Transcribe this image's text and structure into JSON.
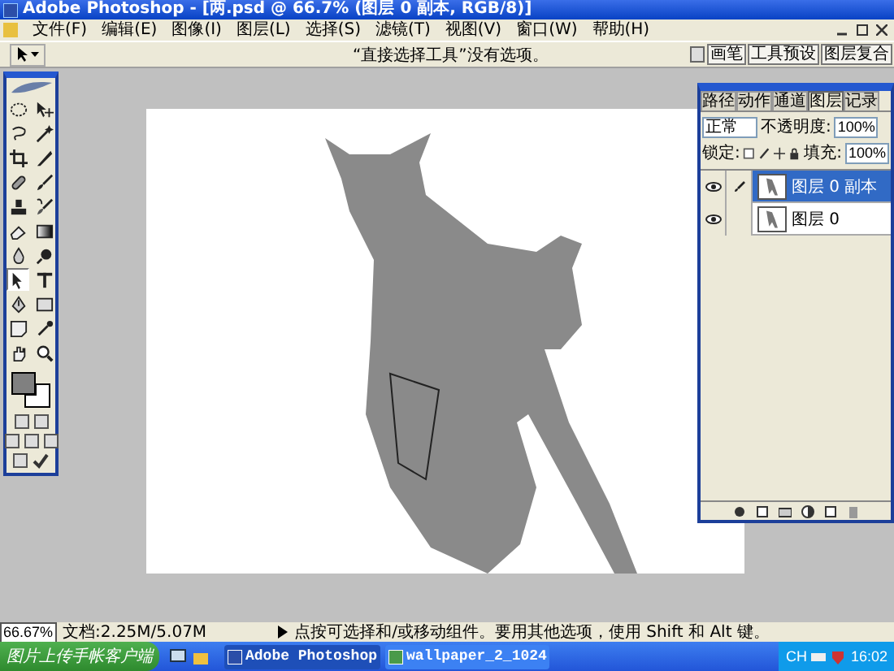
{
  "window": {
    "title": "Adobe Photoshop - [两.psd @ 66.7% (图层 0 副本, RGB/8)]"
  },
  "menu": [
    "文件(F)",
    "编辑(E)",
    "图像(I)",
    "图层(L)",
    "选择(S)",
    "滤镜(T)",
    "视图(V)",
    "窗口(W)",
    "帮助(H)"
  ],
  "options_bar": {
    "hint": "“直接选择工具”没有选项。",
    "palette_well": [
      "画笔",
      "工具预设",
      "图层复合"
    ]
  },
  "toolbox": {
    "tools": [
      {
        "kind": "marquee",
        "selected": false
      },
      {
        "kind": "move",
        "selected": false
      },
      {
        "kind": "lasso",
        "selected": false
      },
      {
        "kind": "wand",
        "selected": false
      },
      {
        "kind": "crop",
        "selected": false
      },
      {
        "kind": "slice",
        "selected": false
      },
      {
        "kind": "healing",
        "selected": false
      },
      {
        "kind": "brush",
        "selected": false
      },
      {
        "kind": "stamp",
        "selected": false
      },
      {
        "kind": "history",
        "selected": false
      },
      {
        "kind": "eraser",
        "selected": false
      },
      {
        "kind": "gradient",
        "selected": false
      },
      {
        "kind": "blur",
        "selected": false
      },
      {
        "kind": "dodge",
        "selected": false
      },
      {
        "kind": "pathselect",
        "selected": true
      },
      {
        "kind": "type",
        "selected": false
      },
      {
        "kind": "pen",
        "selected": false
      },
      {
        "kind": "shape",
        "selected": false
      },
      {
        "kind": "notes",
        "selected": false
      },
      {
        "kind": "eyedropper",
        "selected": false
      },
      {
        "kind": "hand",
        "selected": false
      },
      {
        "kind": "zoom",
        "selected": false
      }
    ]
  },
  "layers_palette": {
    "tabs": [
      {
        "label": "路径",
        "selected": false
      },
      {
        "label": "动作",
        "selected": false
      },
      {
        "label": "通道",
        "selected": false
      },
      {
        "label": "图层",
        "selected": true
      },
      {
        "label": "记录",
        "selected": false
      }
    ],
    "blend_mode": "正常",
    "opacity_label": "不透明度:",
    "opacity": "100%",
    "lock_label": "锁定:",
    "fill_label": "填充:",
    "fill": "100%",
    "layers": [
      {
        "name": "图层 0 副本",
        "visible": true,
        "selected": true
      },
      {
        "name": "图层 0",
        "visible": true,
        "selected": false
      }
    ]
  },
  "status_bar": {
    "zoom": "66.67%",
    "document": "文档:2.25M/5.07M",
    "hint": "点按可选择和/或移动组件。要用其他选项，使用 Shift 和 Alt 键。"
  },
  "taskbar": {
    "start": "图片上传手帐客户端",
    "tasks": [
      {
        "label": "Adobe Photoshop",
        "selected": true
      },
      {
        "label": "wallpaper_2_1024",
        "selected": false
      }
    ],
    "language": "CH",
    "clock": "16:02"
  }
}
